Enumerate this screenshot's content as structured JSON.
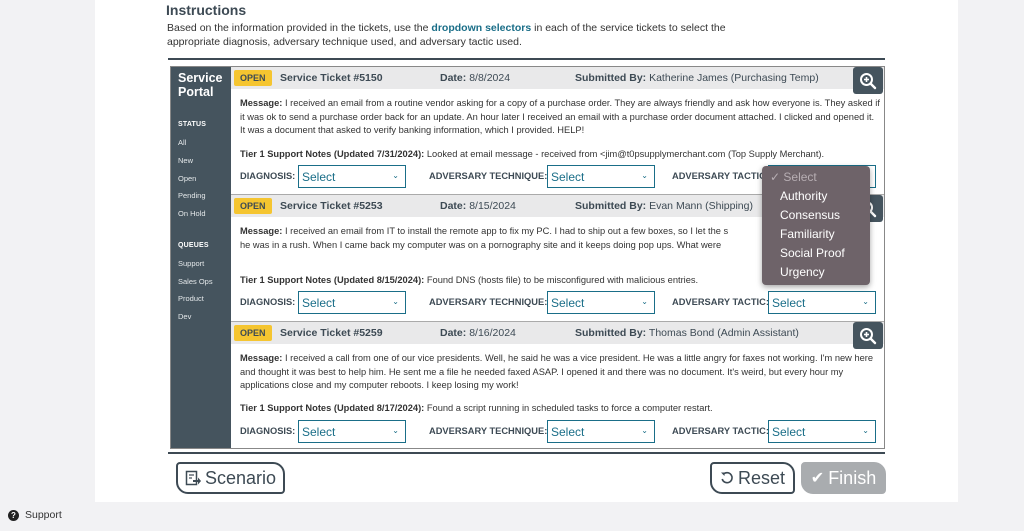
{
  "instructions": {
    "title": "Instructions",
    "text_before": "Based on the information provided in the tickets, use the ",
    "highlight": "dropdown selectors",
    "text_after": " in each of the service tickets to select the appropriate diagnosis, adversary technique used, and adversary tactic used."
  },
  "sidebar": {
    "title_line1": "Service",
    "title_line2": "Portal",
    "status_heading": "STATUS",
    "status_items": [
      "All",
      "New",
      "Open",
      "Pending",
      "On Hold"
    ],
    "queues_heading": "QUEUES",
    "queue_items": [
      "Support",
      "Sales Ops",
      "Product",
      "Dev"
    ]
  },
  "labels": {
    "date": "Date:",
    "submitted_by": "Submitted By:",
    "message": "Message:",
    "diagnosis": "DIAGNOSIS:",
    "technique": "ADVERSARY TECHNIQUE:",
    "tactic": "ADVERSARY TACTIC:",
    "tactic_truncated": "ADVERSARY TACTIC",
    "select_placeholder": "Select"
  },
  "tickets": [
    {
      "status": "OPEN",
      "title": "Service Ticket #5150",
      "date": "8/8/2024",
      "submitted_by": "Katherine James (Purchasing Temp)",
      "message": "I received an email from a routine vendor asking for a copy of a purchase order. They are always friendly and ask how everyone is. They asked if it was ok to send a purchase order back for an update. An hour later I received an email with a purchase order document attached. I clicked and opened it. It was a document that asked to verify banking information, which I provided. HELP!",
      "notes_label": "Tier 1 Support Notes (Updated 7/31/2024):",
      "notes": "Looked at email message - received from <jim@t0psupplymerchant.com (Top Supply Merchant).",
      "diagnosis": "Select",
      "technique": "Select",
      "tactic": "Select"
    },
    {
      "status": "OPEN",
      "title": "Service Ticket #5253",
      "date": "8/15/2024",
      "submitted_by": "Evan Mann (Shipping)",
      "message": "I received an email from IT to install the remote app to fix my PC. I had to ship out a few boxes, so I let the s... he was in a rush. When I came back my computer was on a pornography site and it keeps doing pop ups. What were...",
      "message_line1": "I received an email from IT to install the remote app to fix my PC. I had to ship out a few boxes, so I let the s",
      "message_line2": "he was in a rush. When I came back my computer was on a pornography site and it keeps doing pop ups. What were",
      "notes_label": "Tier 1 Support Notes (Updated 8/15/2024):",
      "notes": "Found DNS (hosts file) to be misconfigured with malicious entries.",
      "diagnosis": "Select",
      "technique": "Select",
      "tactic": "Select"
    },
    {
      "status": "OPEN",
      "title": "Service Ticket #5259",
      "date": "8/16/2024",
      "submitted_by": "Thomas Bond (Admin Assistant)",
      "message": "I received a call from one of our vice presidents. Well, he said he was a vice president. He was a little angry for faxes not working. I'm new here and thought it was best to help him. He sent me a file he needed faxed ASAP. I opened it and there was no document. It's weird, but every hour my applications close and my computer reboots. I keep losing my work!",
      "notes_label": "Tier 1 Support Notes (Updated 8/17/2024):",
      "notes": "Found a script running in scheduled tasks to force a computer restart.",
      "diagnosis": "Select",
      "technique": "Select",
      "tactic": "Select"
    }
  ],
  "open_dropdown": {
    "selected": "Select",
    "options": [
      "Select",
      "Authority",
      "Consensus",
      "Familiarity",
      "Social Proof",
      "Urgency"
    ]
  },
  "buttons": {
    "scenario": "Scenario",
    "reset": "Reset",
    "finish": "Finish"
  },
  "footer": {
    "support": "Support"
  },
  "colors": {
    "accent": "#1a6e88",
    "sidebar": "#45545e",
    "badge": "#f5c530",
    "finish_disabled": "#a9acaf"
  }
}
